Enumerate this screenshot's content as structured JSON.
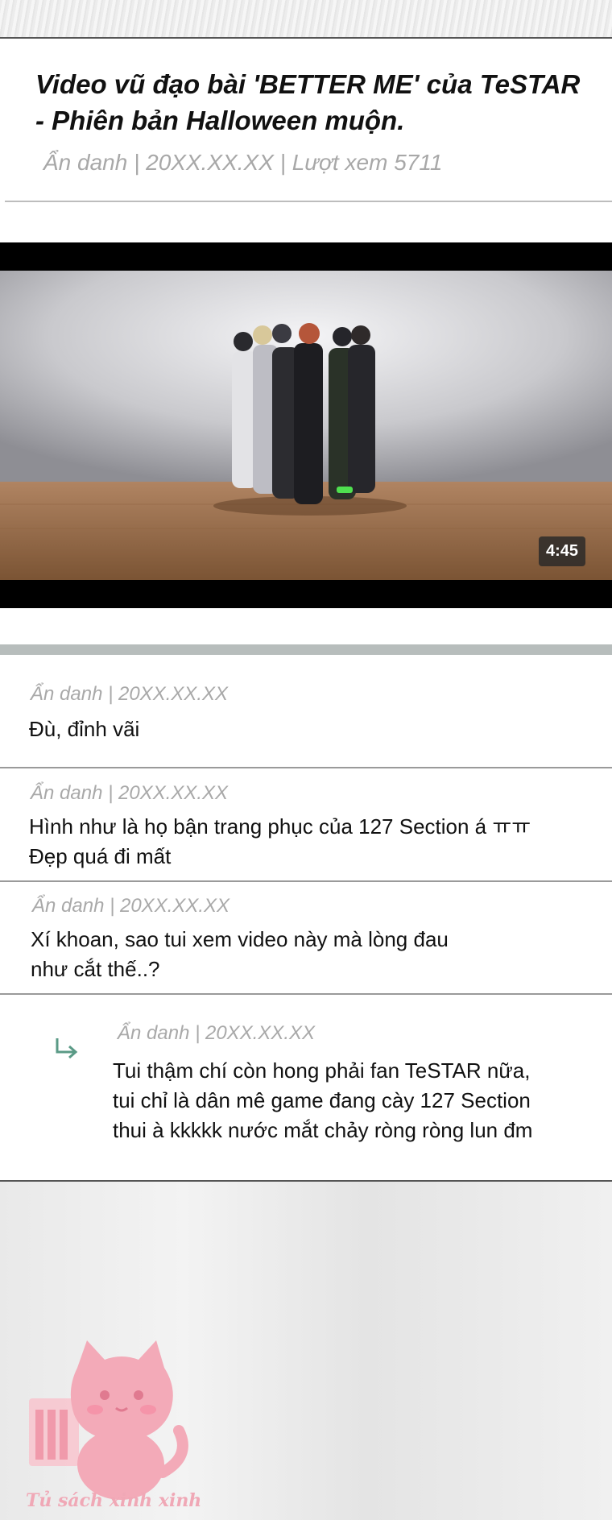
{
  "post": {
    "title": "Video vũ đạo bài 'BETTER ME' của TeSTAR - Phiên bản Halloween muộn.",
    "meta": "Ẩn danh | 20XX.XX.XX | Lượt xem 5711"
  },
  "video": {
    "duration": "4:45"
  },
  "comments": [
    {
      "meta": "Ẩn danh | 20XX.XX.XX",
      "line1": "Đù, đỉnh vãi",
      "line2": ""
    },
    {
      "meta": "Ẩn danh | 20XX.XX.XX",
      "line1": "Hình như là họ bận trang phục của 127 Section á ㅠㅠ",
      "line2": "Đẹp quá đi mất"
    },
    {
      "meta": "Ẩn danh | 20XX.XX.XX",
      "line1": "Xí khoan, sao tui xem video này mà lòng đau",
      "line2": "như cắt thế..?"
    }
  ],
  "reply": {
    "meta": "Ẩn danh | 20XX.XX.XX",
    "line1": "Tui thậm chí còn hong phải fan TeSTAR nữa,",
    "line2": "tui chỉ là dân mê game đang cày 127 Section",
    "line3": "thui à kkkkk nước mắt chảy ròng ròng lun đm",
    "icon": "reply-arrow-icon",
    "icon_color": "#5a9a86"
  },
  "watermark": {
    "text": "Tủ sách xinh xinh",
    "color": "#f0a8b6"
  }
}
